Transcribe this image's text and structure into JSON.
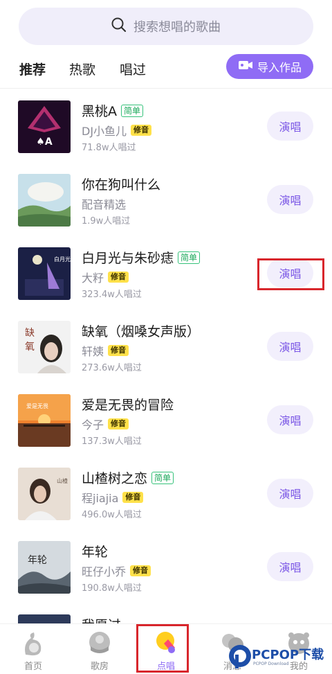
{
  "search": {
    "placeholder": "搜索想唱的歌曲",
    "icon": "search-icon"
  },
  "tabs": [
    {
      "label": "推荐",
      "active": true
    },
    {
      "label": "热歌",
      "active": false
    },
    {
      "label": "唱过",
      "active": false
    }
  ],
  "import_button": {
    "label": "导入作品",
    "icon": "video-camera-icon"
  },
  "songs": [
    {
      "title": "黑桃A",
      "easy_tag": "简单",
      "artist": "DJ小鱼儿",
      "tune_tag": "修音",
      "plays": "71.8w人唱过",
      "sing_label": "演唱",
      "cover_colors": [
        "#2a0b30",
        "#c0367a"
      ]
    },
    {
      "title": "你在狗叫什么",
      "easy_tag": "",
      "artist": "配音精选",
      "tune_tag": "",
      "plays": "1.9w人唱过",
      "sing_label": "演唱",
      "cover_colors": [
        "#bcd8e6",
        "#5f8a52"
      ]
    },
    {
      "title": "白月光与朱砂痣",
      "easy_tag": "简单",
      "artist": "大籽",
      "tune_tag": "修音",
      "plays": "323.4w人唱过",
      "sing_label": "演唱",
      "cover_colors": [
        "#1c2146",
        "#8d6cc7"
      ]
    },
    {
      "title": "缺氧（烟嗓女声版）",
      "easy_tag": "",
      "artist": "轩姨",
      "tune_tag": "修音",
      "plays": "273.6w人唱过",
      "sing_label": "演唱",
      "cover_colors": [
        "#efefef",
        "#c7c2bd"
      ]
    },
    {
      "title": "爱是无畏的冒险",
      "easy_tag": "",
      "artist": "今子",
      "tune_tag": "修音",
      "plays": "137.3w人唱过",
      "sing_label": "演唱",
      "cover_colors": [
        "#ef7d2b",
        "#5b3420"
      ]
    },
    {
      "title": "山楂树之恋",
      "easy_tag": "简单",
      "artist": "程jiajia",
      "tune_tag": "修音",
      "plays": "496.0w人唱过",
      "sing_label": "演唱",
      "cover_colors": [
        "#e7ddd4",
        "#5a4639"
      ]
    },
    {
      "title": "年轮",
      "easy_tag": "",
      "artist": "旺仔小乔",
      "tune_tag": "修音",
      "plays": "190.8w人唱过",
      "sing_label": "演唱",
      "cover_colors": [
        "#cfd6db",
        "#4d5762"
      ]
    },
    {
      "title": "我愿过",
      "easy_tag": "",
      "artist": "",
      "tune_tag": "",
      "plays": "",
      "sing_label": "",
      "cover_colors": [
        "#2d3a5a",
        "#2d3a5a"
      ]
    }
  ],
  "bottom_nav": [
    {
      "label": "首页",
      "icon": "home-icon",
      "active": false
    },
    {
      "label": "歌房",
      "icon": "room-icon",
      "active": false
    },
    {
      "label": "点唱",
      "icon": "sing-icon",
      "active": true
    },
    {
      "label": "消息",
      "icon": "message-icon",
      "active": false
    },
    {
      "label": "我的",
      "icon": "profile-icon",
      "active": false
    }
  ],
  "watermark": {
    "text": "PCPOP下载",
    "sub": "PCPOP Download"
  },
  "colors": {
    "accent": "#8f6cf5",
    "highlight": "#d8262c",
    "tag_yellow": "#ffe14a",
    "tag_green": "#35c27a"
  }
}
